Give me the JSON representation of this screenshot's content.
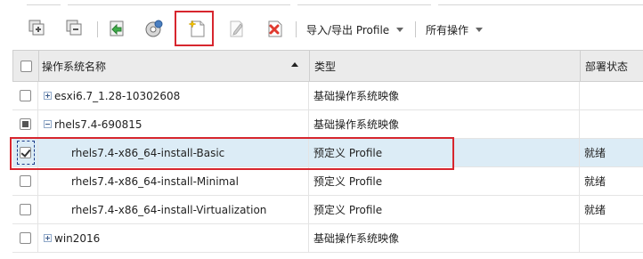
{
  "toolbar": {
    "icons": [
      "add-os-image-icon",
      "remove-os-image-icon",
      "import-icon",
      "deploy-icon",
      "create-profile-icon",
      "edit-profile-icon",
      "delete-profile-icon"
    ],
    "import_export_label": "导入/导出 Profile",
    "all_actions_label": "所有操作"
  },
  "table": {
    "columns": [
      "操作系统名称",
      "类型",
      "部署状态"
    ],
    "sort": {
      "column": "操作系统名称",
      "direction": "asc"
    },
    "rows": [
      {
        "name": "esxi6.7_1.28-10302608",
        "type": "基础操作系统映像",
        "status": "",
        "level": 0,
        "expander": "plus",
        "checkbox": "unchecked",
        "selected": false
      },
      {
        "name": "rhels7.4-690815",
        "type": "基础操作系统映像",
        "status": "",
        "level": 0,
        "expander": "minus",
        "checkbox": "partial",
        "selected": false
      },
      {
        "name": "rhels7.4-x86_64-install-Basic",
        "type": "预定义 Profile",
        "status": "就绪",
        "level": 1,
        "expander": "",
        "checkbox": "checked",
        "selected": true
      },
      {
        "name": "rhels7.4-x86_64-install-Minimal",
        "type": "预定义 Profile",
        "status": "就绪",
        "level": 1,
        "expander": "",
        "checkbox": "unchecked",
        "selected": false
      },
      {
        "name": "rhels7.4-x86_64-install-Virtualization",
        "type": "预定义 Profile",
        "status": "就绪",
        "level": 1,
        "expander": "",
        "checkbox": "unchecked",
        "selected": false
      },
      {
        "name": "win2016",
        "type": "基础操作系统映像",
        "status": "",
        "level": 0,
        "expander": "plus",
        "checkbox": "unchecked",
        "selected": false
      }
    ]
  },
  "colors": {
    "highlight_box": "#d7262e",
    "selected_row": "#dcecf6",
    "header_bg": "#ebebeb"
  }
}
